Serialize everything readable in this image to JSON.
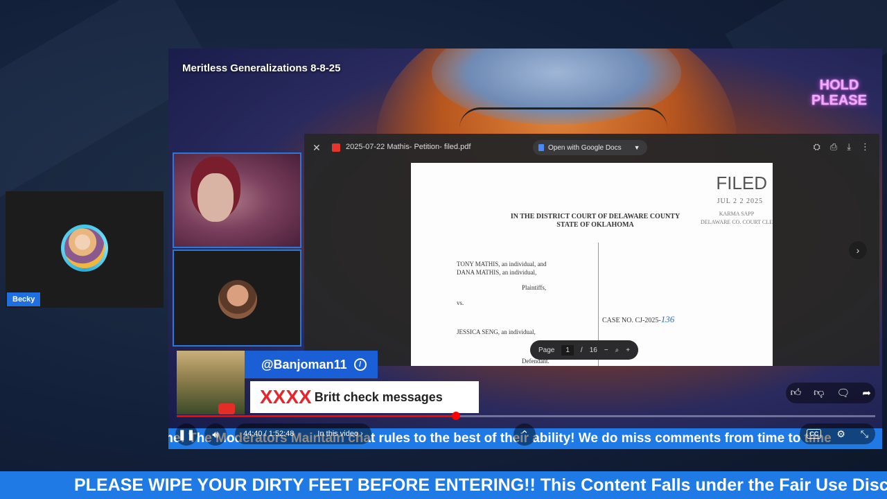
{
  "participant_left": {
    "name": "Becky"
  },
  "video": {
    "title": "Meritless Generalizations 8-8-25",
    "overlay_badge": [
      "HOLD",
      "PLEASE"
    ]
  },
  "pdf_viewer": {
    "close_icon": "close-icon",
    "filename": "2025-07-22 Mathis- Petition- filed.pdf",
    "open_with_label": "Open with Google Docs",
    "tools": [
      "add-to-drive-icon",
      "print-icon",
      "download-icon",
      "more-vert-icon"
    ],
    "page": {
      "filed_stamp": "FILED",
      "filed_date": "JUL 2 2 2025",
      "filed_clerk": [
        "KARMA SAPP",
        "DELAWARE CO. COURT CLE"
      ],
      "court_line1": "IN THE DISTRICT COURT OF DELAWARE COUNTY",
      "court_line2": "STATE OF OKLAHOMA",
      "plaintiff_line1": "TONY MATHIS, an individual, and",
      "plaintiff_line2": "DANA MATHIS, an individual,",
      "plaintiffs_label": "Plaintiffs,",
      "vs": "vs.",
      "defendant_line1": "JESSICA SENG, an individual,",
      "defendant_label": "Defendant.",
      "case_no_label": "CASE NO. CJ-2025-",
      "case_no_handwritten": "136"
    },
    "pager": {
      "label": "Page",
      "current": "1",
      "separator": "/",
      "total": "16"
    }
  },
  "chat": {
    "username": "@Banjoman11",
    "message_prefix": "XXXX",
    "message": "Britt check messages"
  },
  "player": {
    "progress_fraction": 0.4,
    "time_display": "44:40 / 1:52:48",
    "in_this_video": "In this video",
    "accent_color": "#ff0000"
  },
  "ticker_inner": "me! The Moderators Maintain chat rules to the best of their ability! We do miss comments from time to time",
  "ticker_bottom": "PLEASE WIPE YOUR DIRTY FEET BEFORE ENTERING!! This Content Falls under the Fair Use Discl",
  "colors": {
    "banner_blue": "#1f7ae6",
    "chat_user_blue": "#1a5fd6"
  }
}
